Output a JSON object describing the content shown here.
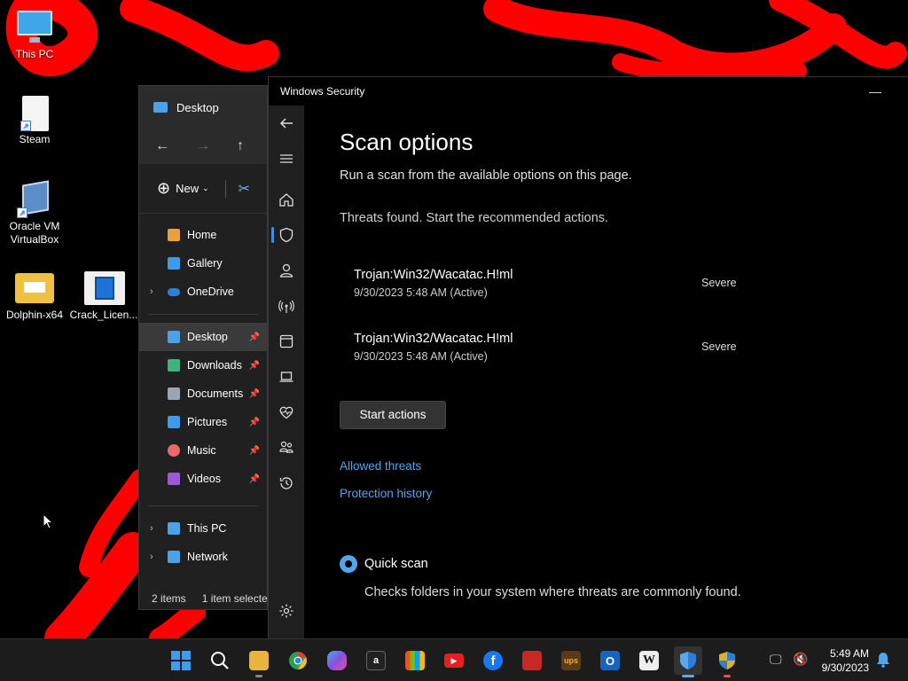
{
  "desktop": {
    "icons": [
      {
        "label": "This PC",
        "icon": "monitor-icon"
      },
      {
        "label": "Steam",
        "icon": "file-shortcut-icon"
      },
      {
        "label": "Oracle VM VirtualBox",
        "icon": "virtualbox-icon"
      },
      {
        "label": "Dolphin-x64",
        "icon": "folder-icon"
      },
      {
        "label": "Crack_Licen...",
        "icon": "installer-icon"
      }
    ],
    "scribble_color": "#ff0000"
  },
  "explorer": {
    "tab_title": "Desktop",
    "new_label": "New",
    "nav_pane": {
      "group1": [
        {
          "label": "Home",
          "icon_color": "#e9a23b"
        },
        {
          "label": "Gallery",
          "icon_color": "#3d9be9"
        },
        {
          "label": "OneDrive",
          "icon_color": "#2f7fd9",
          "expandable": true
        }
      ],
      "quick_access": [
        {
          "label": "Desktop",
          "icon_color": "#4aa3e8",
          "pinned": true,
          "selected": true
        },
        {
          "label": "Downloads",
          "icon_color": "#3fb27f",
          "pinned": true
        },
        {
          "label": "Documents",
          "icon_color": "#9aa6b2",
          "pinned": true
        },
        {
          "label": "Pictures",
          "icon_color": "#3d9be9",
          "pinned": true
        },
        {
          "label": "Music",
          "icon_color": "#e56a6a",
          "pinned": true
        },
        {
          "label": "Videos",
          "icon_color": "#9b59d6",
          "pinned": true
        }
      ],
      "group3": [
        {
          "label": "This PC",
          "icon_color": "#4aa3e8",
          "expandable": true
        },
        {
          "label": "Network",
          "icon_color": "#4aa3e8",
          "expandable": true
        }
      ]
    },
    "status": {
      "items": "2 items",
      "selected": "1 item selecte"
    }
  },
  "security": {
    "window_title": "Windows Security",
    "page_title": "Scan options",
    "subtitle": "Run a scan from the available options on this page.",
    "threat_message": "Threats found. Start the recommended actions.",
    "threats": [
      {
        "name": "Trojan:Win32/Wacatac.H!ml",
        "time": "9/30/2023 5:48 AM (Active)",
        "severity": "Severe"
      },
      {
        "name": "Trojan:Win32/Wacatac.H!ml",
        "time": "9/30/2023 5:48 AM (Active)",
        "severity": "Severe"
      }
    ],
    "start_button": "Start actions",
    "links": {
      "allowed": "Allowed threats",
      "history": "Protection history"
    },
    "quick_scan": {
      "label": "Quick scan",
      "description": "Checks folders in your system where threats are commonly found.",
      "selected": true
    },
    "accent": "#4ea6f0"
  },
  "taskbar": {
    "apps": [
      {
        "name": "start-icon",
        "color": "#3b9cf0",
        "glyph": ""
      },
      {
        "name": "search-icon",
        "color": "transparent",
        "glyph": ""
      },
      {
        "name": "file-explorer-icon",
        "color": "#e9b43b",
        "glyph": ""
      },
      {
        "name": "chrome-icon",
        "color": "#2e9e4f",
        "glyph": ""
      },
      {
        "name": "copilot-icon",
        "color": "#6a5fd6",
        "glyph": ""
      },
      {
        "name": "amazon-icon",
        "color": "#222",
        "glyph": "a"
      },
      {
        "name": "store-icon",
        "color": "#444",
        "glyph": ""
      },
      {
        "name": "youtube-icon",
        "color": "#e52020",
        "glyph": "▶"
      },
      {
        "name": "facebook-icon",
        "color": "#1877f2",
        "glyph": "f"
      },
      {
        "name": "news-icon",
        "color": "#c62828",
        "glyph": ""
      },
      {
        "name": "ups-icon",
        "color": "#5a3a1a",
        "glyph": "ups"
      },
      {
        "name": "outlook-icon",
        "color": "#1565c0",
        "glyph": "O"
      },
      {
        "name": "wikipedia-icon",
        "color": "#eee",
        "glyph": "W"
      },
      {
        "name": "windows-security-icon",
        "color": "#2a7fd6",
        "glyph": ""
      },
      {
        "name": "security-shield-icon",
        "color": "#e0b020",
        "glyph": ""
      }
    ],
    "time": "5:49 AM",
    "date": "9/30/2023"
  }
}
